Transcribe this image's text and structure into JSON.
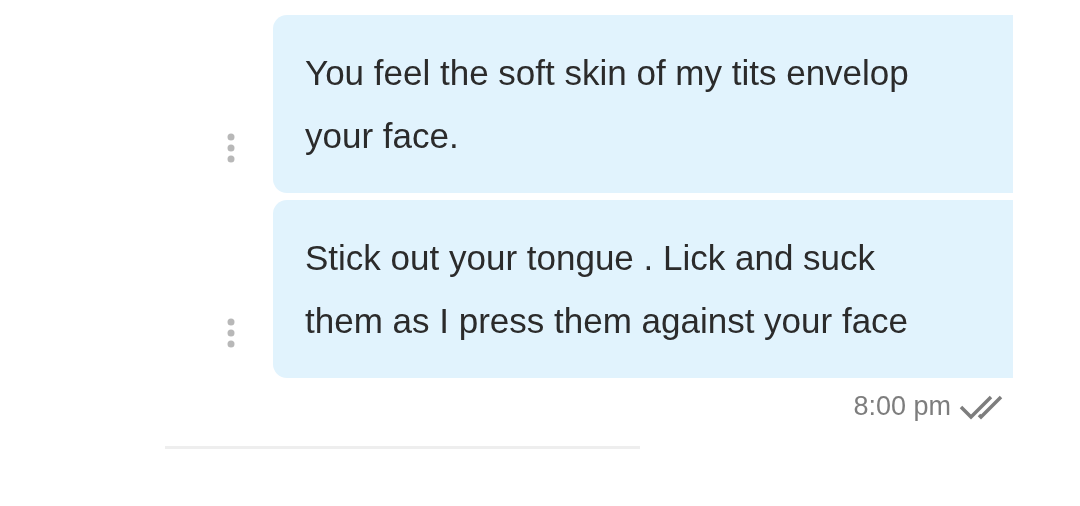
{
  "messages": [
    {
      "text": "You feel the soft skin of my tits envelop your face."
    },
    {
      "text": "Stick out your tongue . Lick and suck them as I press them against your face"
    }
  ],
  "timestamp": "8:00 pm"
}
